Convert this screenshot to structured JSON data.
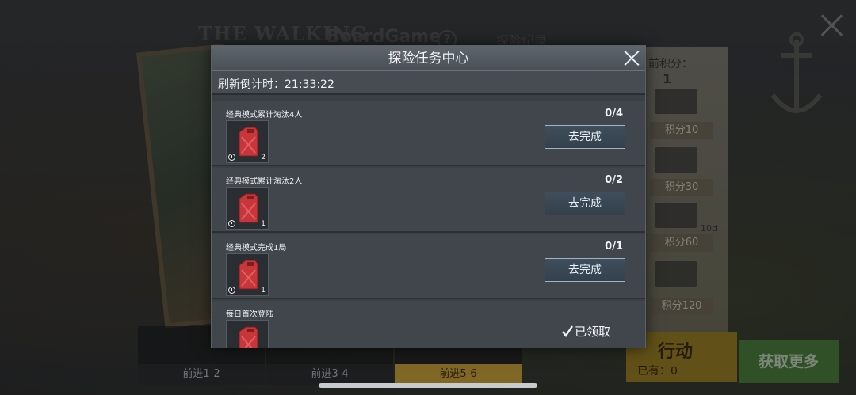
{
  "background": {
    "title_main": "THE WALKING",
    "title_sub": "BoardGame",
    "help_icon": "?",
    "record_label": "探险纪录",
    "points_label": "前积分：",
    "points_value": "1",
    "tiers": [
      "积分10",
      "积分30",
      "积分60",
      "积分120"
    ],
    "tier_note": "10d",
    "bottom_tabs": [
      "前进1-2",
      "前进3-4",
      "前进5-6"
    ],
    "action_label": "行动",
    "action_owned": "已有：0",
    "more_label": "获取更多"
  },
  "dialog": {
    "title": "探险任务中心",
    "refresh_label": "刷新倒计时：21:33:22",
    "tasks": [
      {
        "name": "经典模式累计淘汰4人",
        "progress": "0/4",
        "reward_count": "2",
        "action": "去完成",
        "reward_icon": "jerrycan-icon"
      },
      {
        "name": "经典模式累计淘汰2人",
        "progress": "0/2",
        "reward_count": "1",
        "action": "去完成",
        "reward_icon": "jerrycan-icon"
      },
      {
        "name": "经典模式完成1局",
        "progress": "0/1",
        "reward_count": "1",
        "action": "去完成",
        "reward_icon": "jerrycan-icon"
      },
      {
        "name": "每日首次登陆",
        "progress": "",
        "reward_count": "",
        "action": "已领取",
        "reward_icon": "jerrycan-icon"
      }
    ]
  },
  "colors": {
    "dialog_bg": "#3b4045",
    "button_border": "#9fb4c6",
    "active_tab": "#e0b23a",
    "more_button": "#4f8a3e",
    "jerrycan_red": "#c8363a"
  }
}
